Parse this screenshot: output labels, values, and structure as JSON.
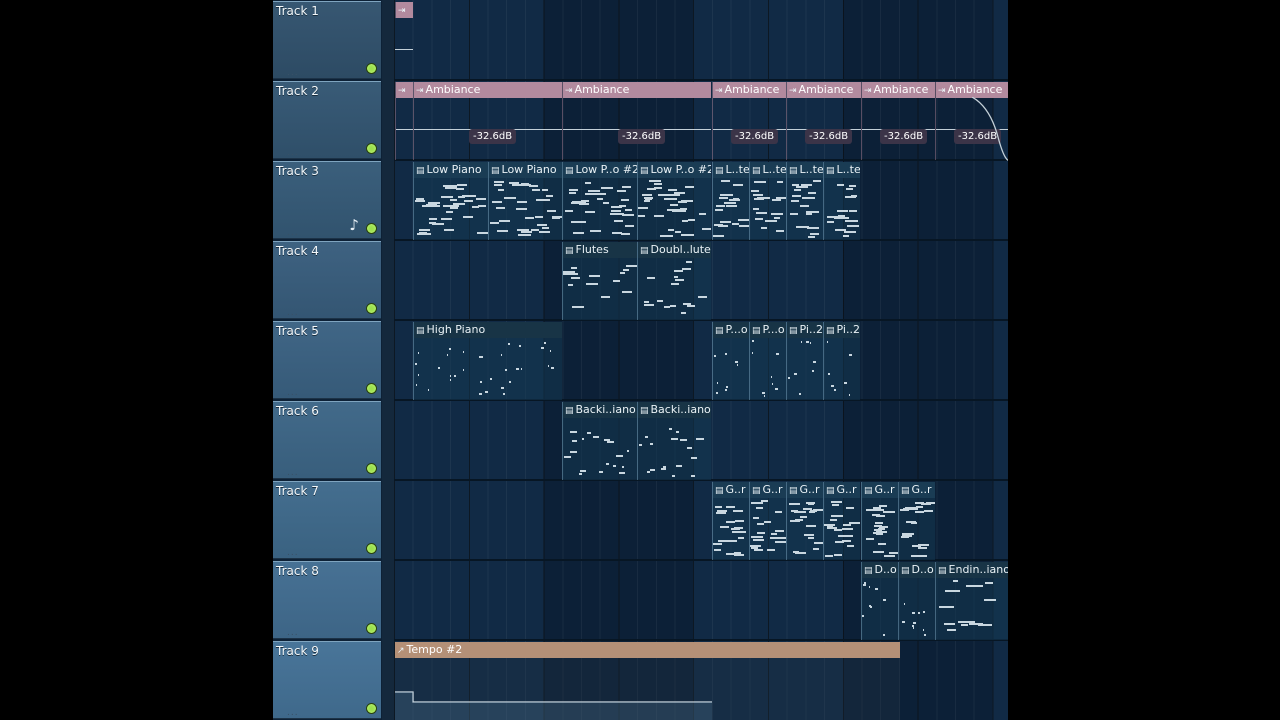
{
  "tracks": [
    {
      "name": "Track 1"
    },
    {
      "name": "Track 2"
    },
    {
      "name": "Track 3"
    },
    {
      "name": "Track 4"
    },
    {
      "name": "Track 5"
    },
    {
      "name": "Track 6"
    },
    {
      "name": "Track 7"
    },
    {
      "name": "Track 8"
    },
    {
      "name": "Track 9"
    }
  ],
  "track_dots": "...",
  "clips": {
    "audio_label": "Ambiance",
    "audio_volume": "-32.6dB",
    "track3": [
      "Low Piano",
      "Low Piano",
      "Low P..o #2",
      "Low P..o #2",
      "L..te",
      "L..te",
      "L..te",
      "L..te"
    ],
    "track4": [
      "Flutes",
      "Doubl..lutes"
    ],
    "track5": [
      "High Piano",
      "P...o",
      "P...o",
      "Pi..2",
      "Pi..2"
    ],
    "track6": [
      "Backi..iano",
      "Backi..iano"
    ],
    "track7": [
      "G..r",
      "G..r",
      "G..r",
      "G..r",
      "G..r",
      "G..r"
    ],
    "track8": [
      "D..o",
      "D..o",
      "Endin..iano"
    ],
    "track9": "Tempo #2"
  },
  "icons": {
    "pattern": "piano-roll-icon",
    "audio": "audio-clip-icon",
    "automation": "automation-icon",
    "note": "note-icon",
    "led": "track-active-led"
  },
  "colors": {
    "background": "#0d2136",
    "track_header": "#5d87a7",
    "audio_clip": "#b28a9e",
    "automation_clip": "#b49077",
    "led": "#9be04e"
  }
}
